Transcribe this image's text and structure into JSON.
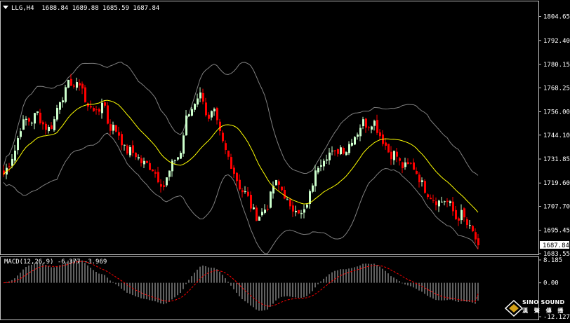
{
  "header": {
    "symbol": "LLG,H4",
    "ohlc": "1688.84 1689.88 1685.59 1687.84"
  },
  "macd_header": {
    "label": "MACD(12,26,9) -6.377 -3.969"
  },
  "logo": {
    "line1": "SINO SOUND",
    "line2": "漢 聲 傳 播"
  },
  "colors": {
    "background": "#000000",
    "grid_frame": "#c0c0c0",
    "bull": "#ccffcc",
    "bear": "#ff0000",
    "ma": "#ffff00",
    "bands": "#808080",
    "macd_hist": "#c0c0c0",
    "macd_signal": "#ff0000",
    "axis_text": "#ffffff",
    "price_tag_bg": "#ffffff",
    "price_tag_text": "#000000"
  },
  "chart_data": [
    {
      "type": "candlestick",
      "symbol": "LLG",
      "timeframe": "H4",
      "current_price": 1687.84,
      "ylim": [
        1683.55,
        1812.0
      ],
      "y_ticks": [
        "1804.65",
        "1792.40",
        "1780.15",
        "1768.25",
        "1756.00",
        "1744.10",
        "1731.85",
        "1719.60",
        "1707.70",
        "1695.45",
        "1683.55"
      ],
      "overlays": [
        "moving average (yellow)",
        "bollinger bands (gray)"
      ],
      "close_path": [
        1724,
        1730,
        1736,
        1748,
        1752,
        1751,
        1756,
        1750,
        1747,
        1750,
        1762,
        1765,
        1772,
        1768,
        1772,
        1757,
        1760,
        1753,
        1764,
        1748,
        1748,
        1744,
        1736,
        1736,
        1734,
        1730,
        1729,
        1727,
        1722,
        1718,
        1725,
        1732,
        1734,
        1752,
        1757,
        1764,
        1765,
        1750,
        1757,
        1746,
        1737,
        1731,
        1723,
        1716,
        1714,
        1706,
        1702,
        1705,
        1709,
        1720,
        1718,
        1713,
        1705,
        1708,
        1703,
        1708,
        1720,
        1729,
        1733,
        1735,
        1734,
        1738,
        1736,
        1742,
        1745,
        1751,
        1749,
        1752,
        1745,
        1740,
        1734,
        1735,
        1728,
        1728,
        1729,
        1724,
        1718,
        1714,
        1711,
        1710,
        1711,
        1708,
        1701,
        1704,
        1698,
        1694,
        1688
      ]
    },
    {
      "type": "bar",
      "name": "MACD(12,26,9)",
      "ylim": [
        -12.127,
        8.185
      ],
      "y_ticks": [
        "8.185",
        "0.00",
        "-12.127"
      ],
      "values": [
        -6.377
      ],
      "signal": [
        -3.969
      ]
    }
  ]
}
